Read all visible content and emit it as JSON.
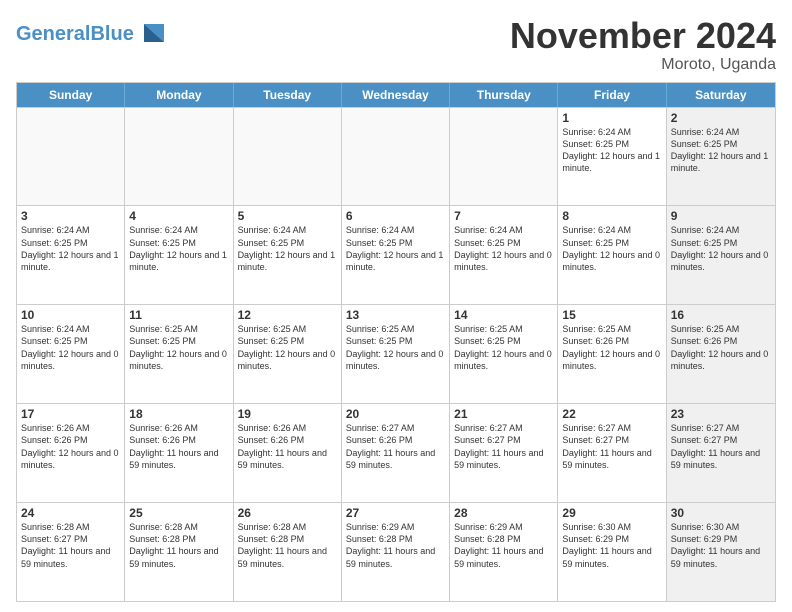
{
  "header": {
    "logo_general": "General",
    "logo_blue": "Blue",
    "month": "November 2024",
    "location": "Moroto, Uganda"
  },
  "weekdays": [
    "Sunday",
    "Monday",
    "Tuesday",
    "Wednesday",
    "Thursday",
    "Friday",
    "Saturday"
  ],
  "rows": [
    [
      {
        "day": "",
        "info": "",
        "shaded": false,
        "empty": true
      },
      {
        "day": "",
        "info": "",
        "shaded": false,
        "empty": true
      },
      {
        "day": "",
        "info": "",
        "shaded": false,
        "empty": true
      },
      {
        "day": "",
        "info": "",
        "shaded": false,
        "empty": true
      },
      {
        "day": "",
        "info": "",
        "shaded": false,
        "empty": true
      },
      {
        "day": "1",
        "info": "Sunrise: 6:24 AM\nSunset: 6:25 PM\nDaylight: 12 hours and 1 minute.",
        "shaded": false,
        "empty": false
      },
      {
        "day": "2",
        "info": "Sunrise: 6:24 AM\nSunset: 6:25 PM\nDaylight: 12 hours and 1 minute.",
        "shaded": true,
        "empty": false
      }
    ],
    [
      {
        "day": "3",
        "info": "Sunrise: 6:24 AM\nSunset: 6:25 PM\nDaylight: 12 hours and 1 minute.",
        "shaded": false,
        "empty": false
      },
      {
        "day": "4",
        "info": "Sunrise: 6:24 AM\nSunset: 6:25 PM\nDaylight: 12 hours and 1 minute.",
        "shaded": false,
        "empty": false
      },
      {
        "day": "5",
        "info": "Sunrise: 6:24 AM\nSunset: 6:25 PM\nDaylight: 12 hours and 1 minute.",
        "shaded": false,
        "empty": false
      },
      {
        "day": "6",
        "info": "Sunrise: 6:24 AM\nSunset: 6:25 PM\nDaylight: 12 hours and 1 minute.",
        "shaded": false,
        "empty": false
      },
      {
        "day": "7",
        "info": "Sunrise: 6:24 AM\nSunset: 6:25 PM\nDaylight: 12 hours and 0 minutes.",
        "shaded": false,
        "empty": false
      },
      {
        "day": "8",
        "info": "Sunrise: 6:24 AM\nSunset: 6:25 PM\nDaylight: 12 hours and 0 minutes.",
        "shaded": false,
        "empty": false
      },
      {
        "day": "9",
        "info": "Sunrise: 6:24 AM\nSunset: 6:25 PM\nDaylight: 12 hours and 0 minutes.",
        "shaded": true,
        "empty": false
      }
    ],
    [
      {
        "day": "10",
        "info": "Sunrise: 6:24 AM\nSunset: 6:25 PM\nDaylight: 12 hours and 0 minutes.",
        "shaded": false,
        "empty": false
      },
      {
        "day": "11",
        "info": "Sunrise: 6:25 AM\nSunset: 6:25 PM\nDaylight: 12 hours and 0 minutes.",
        "shaded": false,
        "empty": false
      },
      {
        "day": "12",
        "info": "Sunrise: 6:25 AM\nSunset: 6:25 PM\nDaylight: 12 hours and 0 minutes.",
        "shaded": false,
        "empty": false
      },
      {
        "day": "13",
        "info": "Sunrise: 6:25 AM\nSunset: 6:25 PM\nDaylight: 12 hours and 0 minutes.",
        "shaded": false,
        "empty": false
      },
      {
        "day": "14",
        "info": "Sunrise: 6:25 AM\nSunset: 6:25 PM\nDaylight: 12 hours and 0 minutes.",
        "shaded": false,
        "empty": false
      },
      {
        "day": "15",
        "info": "Sunrise: 6:25 AM\nSunset: 6:26 PM\nDaylight: 12 hours and 0 minutes.",
        "shaded": false,
        "empty": false
      },
      {
        "day": "16",
        "info": "Sunrise: 6:25 AM\nSunset: 6:26 PM\nDaylight: 12 hours and 0 minutes.",
        "shaded": true,
        "empty": false
      }
    ],
    [
      {
        "day": "17",
        "info": "Sunrise: 6:26 AM\nSunset: 6:26 PM\nDaylight: 12 hours and 0 minutes.",
        "shaded": false,
        "empty": false
      },
      {
        "day": "18",
        "info": "Sunrise: 6:26 AM\nSunset: 6:26 PM\nDaylight: 11 hours and 59 minutes.",
        "shaded": false,
        "empty": false
      },
      {
        "day": "19",
        "info": "Sunrise: 6:26 AM\nSunset: 6:26 PM\nDaylight: 11 hours and 59 minutes.",
        "shaded": false,
        "empty": false
      },
      {
        "day": "20",
        "info": "Sunrise: 6:27 AM\nSunset: 6:26 PM\nDaylight: 11 hours and 59 minutes.",
        "shaded": false,
        "empty": false
      },
      {
        "day": "21",
        "info": "Sunrise: 6:27 AM\nSunset: 6:27 PM\nDaylight: 11 hours and 59 minutes.",
        "shaded": false,
        "empty": false
      },
      {
        "day": "22",
        "info": "Sunrise: 6:27 AM\nSunset: 6:27 PM\nDaylight: 11 hours and 59 minutes.",
        "shaded": false,
        "empty": false
      },
      {
        "day": "23",
        "info": "Sunrise: 6:27 AM\nSunset: 6:27 PM\nDaylight: 11 hours and 59 minutes.",
        "shaded": true,
        "empty": false
      }
    ],
    [
      {
        "day": "24",
        "info": "Sunrise: 6:28 AM\nSunset: 6:27 PM\nDaylight: 11 hours and 59 minutes.",
        "shaded": false,
        "empty": false
      },
      {
        "day": "25",
        "info": "Sunrise: 6:28 AM\nSunset: 6:28 PM\nDaylight: 11 hours and 59 minutes.",
        "shaded": false,
        "empty": false
      },
      {
        "day": "26",
        "info": "Sunrise: 6:28 AM\nSunset: 6:28 PM\nDaylight: 11 hours and 59 minutes.",
        "shaded": false,
        "empty": false
      },
      {
        "day": "27",
        "info": "Sunrise: 6:29 AM\nSunset: 6:28 PM\nDaylight: 11 hours and 59 minutes.",
        "shaded": false,
        "empty": false
      },
      {
        "day": "28",
        "info": "Sunrise: 6:29 AM\nSunset: 6:28 PM\nDaylight: 11 hours and 59 minutes.",
        "shaded": false,
        "empty": false
      },
      {
        "day": "29",
        "info": "Sunrise: 6:30 AM\nSunset: 6:29 PM\nDaylight: 11 hours and 59 minutes.",
        "shaded": false,
        "empty": false
      },
      {
        "day": "30",
        "info": "Sunrise: 6:30 AM\nSunset: 6:29 PM\nDaylight: 11 hours and 59 minutes.",
        "shaded": true,
        "empty": false
      }
    ]
  ]
}
